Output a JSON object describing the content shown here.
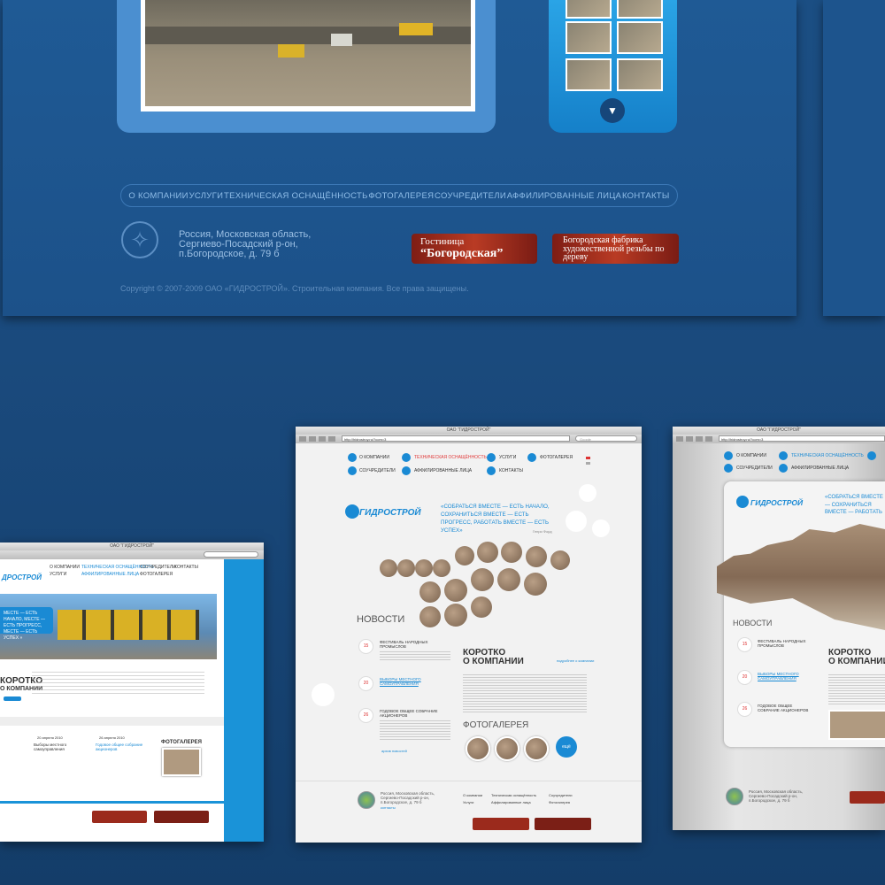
{
  "top": {
    "nav": [
      "О КОМПАНИИ",
      "УСЛУГИ",
      "ТЕХНИЧЕСКАЯ ОСНАЩЁННОСТЬ",
      "ФОТОГАЛЕРЕЯ",
      "СОУЧРЕДИТЕЛИ",
      "АФФИЛИРОВАННЫЕ ЛИЦА",
      "КОНТАКТЫ"
    ],
    "address": "Россия, Московская область,\nСергиево-Посадский р-он,\nп.Богородское, д. 79 б",
    "copyright": "Copyright © 2007-2009 ОАО «ГИДРОСТРОЙ».  Строительная компания. Все права защищены.",
    "banner_hotel_1": "Гостиница",
    "banner_hotel_2": "“Богородская”",
    "banner_factory": "Богородская фабрика художественной резьбы по дереву"
  },
  "win1": {
    "title": "ОАО \"ГИДРОСТРОЙ\"",
    "logo": "ДРОСТРОЙ",
    "nav": [
      "О КОМПАНИИ",
      "ТЕХНИЧЕСКАЯ ОСНАЩЁННОСТЬ",
      "СОУЧРЕДИТЕЛИ",
      "КОНТАКТЫ",
      "УСЛУГИ",
      "АФФИЛИРОВАННЫЕ ЛИЦА",
      "ФОТОГАЛЕРЕЯ"
    ],
    "slogan": "МЕСТЕ — ЕСТЬ НАЧАЛО, МЕСТЕ — ЕСТЬ ПРОГРЕСС, МЕСТЕ — ЕСТЬ УСПЕХ »",
    "about_title": "КОРОТКО",
    "about_sub": "О КОМПАНИИ",
    "gallery": "ФОТОГАЛЕРЕЯ",
    "news1": "Выборы местного самоуправления",
    "news2": "Годовое общее собрание акционеров",
    "date1": "20 апреля 2010",
    "date2": "26 апреля 2010"
  },
  "win2": {
    "title": "ОАО \"ГИДРОСТРОЙ\"",
    "url": "http://hidrostroy.ru/?com=3",
    "search": "Google",
    "nav": [
      "О КОМПАНИИ",
      "ТЕХНИЧЕСКАЯ ОСНАЩЁННОСТЬ",
      "УСЛУГИ",
      "ФОТОГАЛЕРЕЯ",
      "СОУЧРЕДИТЕЛИ",
      "АФФИЛИРОВАННЫЕ ЛИЦА",
      "КОНТАКТЫ"
    ],
    "logo": "ГИДРОСТРОЙ",
    "slogan": "«СОБРАТЬСЯ ВМЕСТЕ — ЕСТЬ НАЧАЛО, СОХРАНИТЬСЯ ВМЕСТЕ — ЕСТЬ ПРОГРЕСС, РАБОТАТЬ ВМЕСТЕ — ЕСТЬ УСПЕХ»",
    "author": "Генри Форд",
    "news_title": "НОВОСТИ",
    "news": [
      {
        "day": "15",
        "month": "сентября 2010",
        "title": "ФЕСТИВАЛЬ НАРОДНЫХ ПРОМЫСЛОВ"
      },
      {
        "day": "20",
        "month": "сентября 2010",
        "title": "ВЫБОРЫ МЕСТНОГО САМОУПРАВЛЕНИЯ"
      },
      {
        "day": "26",
        "month": "сентября 2010",
        "title": "ГОДОВОЕ ОБЩЕЕ СОБРАНИЕ АКЦИОНЕРОВ"
      }
    ],
    "all_news": "архив новостей",
    "about_title": "КОРОТКО",
    "about_sub": "О КОМПАНИИ",
    "about_more": "подробнее о компании",
    "gallery": "ФОТОГАЛЕРЕЯ",
    "gallery_more": "ещё",
    "address": "Россия, Московская область, Сергиево-Посадский р-он, п.Богородское, д. 79 б",
    "contacts": "контакты",
    "footer_nav": [
      "О компании",
      "Техническая оснащённость",
      "Соучредители",
      "Услуги",
      "Аффилированные лица",
      "Фотогалерея"
    ]
  },
  "win3": {
    "title": "ОАО \"ГИДРОСТРОЙ\"",
    "url": "http://hidrostroy.ru/?com=3",
    "nav": [
      "О КОМПАНИИ",
      "ТЕХНИЧЕСКАЯ ОСНАЩЁННОСТЬ",
      "СОУЧРЕДИТЕЛИ",
      "АФФИЛИРОВАННЫЕ ЛИЦА"
    ],
    "logo": "ГИДРОСТРОЙ",
    "slogan": "«СОБРАТЬСЯ ВМЕСТЕ — СОХРАНИТЬСЯ ВМЕСТЕ — РАБОТАТЬ ВМЕСТЕ — ЕС",
    "news_title": "НОВОСТИ",
    "news": [
      {
        "day": "15",
        "title": "ФЕСТИВАЛЬ НАРОДНЫХ ПРОМЫСЛОВ"
      },
      {
        "day": "20",
        "title": "ВЫБОРЫ МЕСТНОГО САМОУПРАВЛЕНИЯ"
      },
      {
        "day": "26",
        "title": "ГОДОВОЕ ОБЩЕЕ СОБРАНИЕ АКЦИОНЕРОВ"
      }
    ],
    "about_title": "КОРОТКО",
    "about_sub": "О КОМПАНИИ",
    "address": "Россия, Московская область, Сергиево-Посадский р-он, п.Богородское, д. 79 б"
  },
  "colors": {
    "accent": "#1a8ad4",
    "background": "#1b4e83",
    "banner": "#b93b24"
  }
}
